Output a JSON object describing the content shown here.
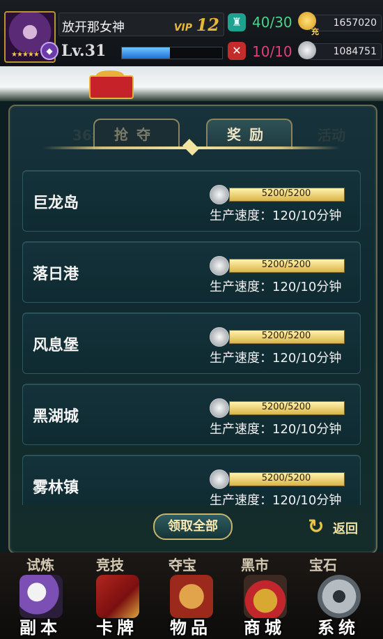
{
  "player": {
    "name": "放开那女神",
    "vip_tag": "VIP",
    "vip_level": "12",
    "level": "Lv.31",
    "xp_fraction": 0.48,
    "stars": "★★★★★"
  },
  "resources": {
    "stamina": "40/30",
    "energy": "10/10",
    "gold": "1657020",
    "silver": "1084751",
    "recharge_label": "充"
  },
  "tabs": {
    "left_side": "36级",
    "plunder": "抢夺",
    "reward": "奖励",
    "right_side": "活动"
  },
  "cities": [
    {
      "name": "巨龙岛",
      "progress": "5200/5200",
      "fill": 1.0,
      "rate": "生产速度：120/10分钟"
    },
    {
      "name": "落日港",
      "progress": "5200/5200",
      "fill": 1.0,
      "rate": "生产速度：120/10分钟"
    },
    {
      "name": "风息堡",
      "progress": "5200/5200",
      "fill": 1.0,
      "rate": "生产速度：120/10分钟"
    },
    {
      "name": "黑湖城",
      "progress": "5200/5200",
      "fill": 1.0,
      "rate": "生产速度：120/10分钟"
    },
    {
      "name": "雾林镇",
      "progress": "5200/5200",
      "fill": 1.0,
      "rate": "生产速度：120/10分钟"
    }
  ],
  "actions": {
    "claim_all": "领取全部",
    "back": "返回"
  },
  "sub_nav": [
    "试炼",
    "竞技",
    "夺宝",
    "黑市",
    "宝石"
  ],
  "nav": [
    {
      "label": "副本",
      "icon": "knight-helmet-icon"
    },
    {
      "label": "卡牌",
      "icon": "cards-icon"
    },
    {
      "label": "物品",
      "icon": "treasure-chest-icon"
    },
    {
      "label": "商城",
      "icon": "gift-shop-icon"
    },
    {
      "label": "系统",
      "icon": "gear-icon"
    }
  ]
}
